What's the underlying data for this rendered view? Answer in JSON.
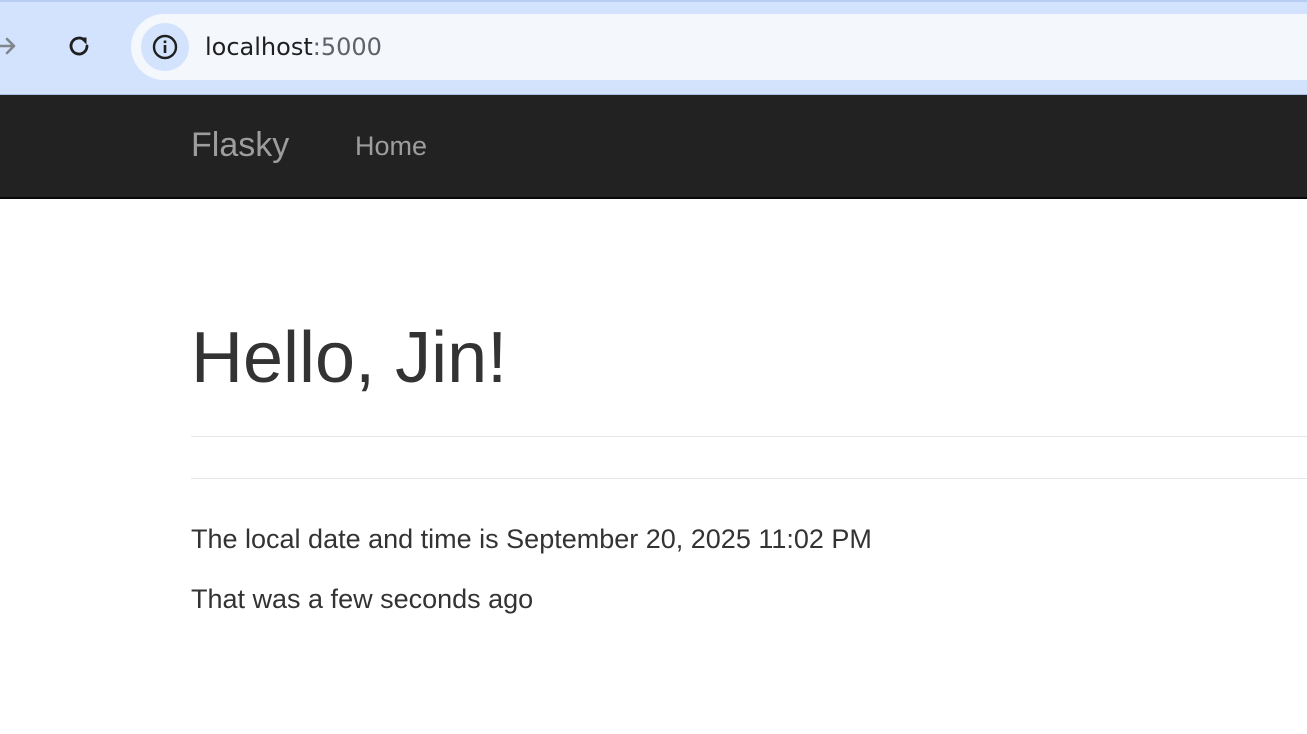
{
  "browser": {
    "url_host": "localhost",
    "url_port": ":5000",
    "icons": {
      "forward": "arrow-right-icon",
      "reload": "reload-icon",
      "site_info": "info-icon"
    }
  },
  "navbar": {
    "brand": "Flasky",
    "links": [
      {
        "label": "Home"
      }
    ]
  },
  "page": {
    "heading": "Hello, Jin!",
    "datetime_line": "The local date and time is September 20, 2025 11:02 PM",
    "relative_line": "That was a few seconds ago"
  },
  "colors": {
    "chrome_bg": "#d3e3fd",
    "omnibox_bg": "#f4f7fc",
    "navbar_bg": "#222222",
    "navbar_text": "#9d9d9d",
    "body_text": "#333333"
  }
}
